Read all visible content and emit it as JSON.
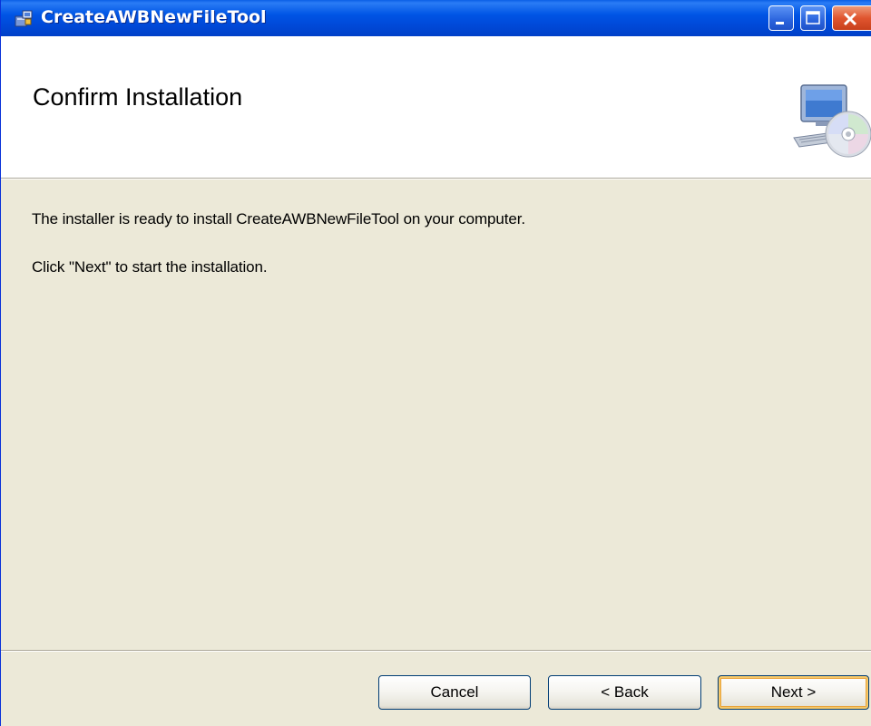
{
  "window": {
    "title": "CreateAWBNewFileTool",
    "icon": "installer-package-icon",
    "controls": {
      "minimize": "minimize-icon",
      "maximize": "maximize-icon",
      "close": "close-icon"
    }
  },
  "banner": {
    "title": "Confirm Installation",
    "icon": "computer-with-cd-icon"
  },
  "body": {
    "line1": "The installer is ready to install CreateAWBNewFileTool on your computer.",
    "line2": "Click \"Next\" to start the installation."
  },
  "buttons": {
    "cancel": "Cancel",
    "back": "< Back",
    "next": "Next >"
  },
  "colors": {
    "titlebar": "#0055e5",
    "dialog_bg": "#ece9d8",
    "banner_bg": "#ffffff",
    "close_button": "#e0552f",
    "default_button_highlight": "#f5c86a"
  }
}
